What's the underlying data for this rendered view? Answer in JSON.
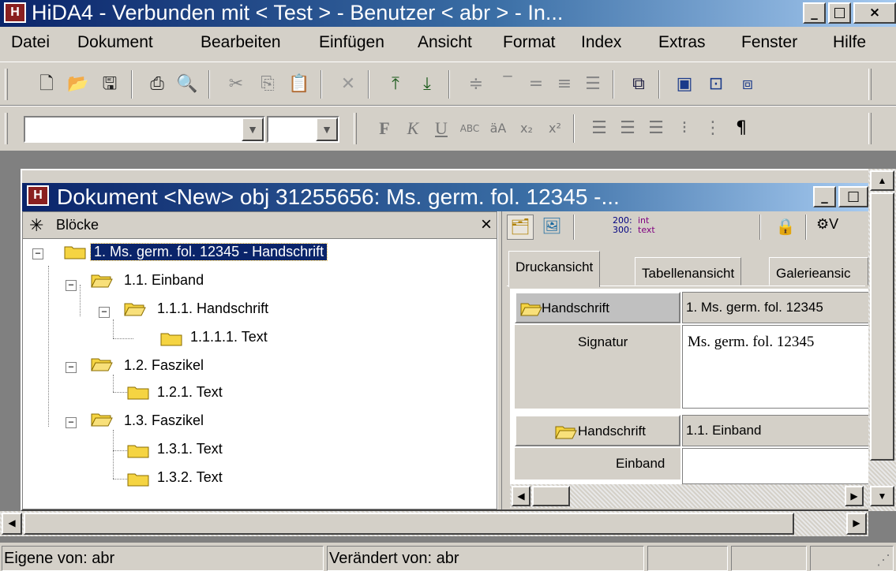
{
  "app": {
    "title": "HiDA4 - Verbunden mit < Test > - Benutzer < abr > - In...",
    "icon_letter": "H"
  },
  "menu": [
    "Datei",
    "Dokument",
    "Bearbeiten",
    "Einfügen",
    "Ansicht",
    "Format",
    "Index",
    "Extras",
    "Fenster",
    "Hilfe"
  ],
  "document": {
    "title": "Dokument <New> obj 31255656: Ms. germ. fol. 12345 -..."
  },
  "blocks": {
    "header": "Blöcke",
    "close": "×",
    "tree": [
      {
        "label": "1. Ms. germ. fol. 12345 - Handschrift",
        "level": 0,
        "selected": true
      },
      {
        "label": "1.1. Einband",
        "level": 1
      },
      {
        "label": "1.1.1. Handschrift",
        "level": 2
      },
      {
        "label": "1.1.1.1. Text",
        "level": 3
      },
      {
        "label": "1.2. Faszikel",
        "level": 1
      },
      {
        "label": "1.2.1. Text",
        "level": 2
      },
      {
        "label": "1.3. Faszikel",
        "level": 1
      },
      {
        "label": "1.3.1. Text",
        "level": 2
      },
      {
        "label": "1.3.2. Text",
        "level": 2
      }
    ]
  },
  "right": {
    "toolbar_code_lines": [
      "200:",
      "300:"
    ],
    "toolbar_code_values": [
      "int",
      "text"
    ],
    "toolbar_cut_label": "V",
    "tabs": [
      "Druckansicht",
      "Tabellenansicht",
      "Galerieansic"
    ],
    "rows": [
      {
        "header": "Handschrift",
        "value": "1. Ms. germ. fol. 12345",
        "field": "Signatur",
        "field_value": "Ms. germ. fol. 12345"
      },
      {
        "header": "Handschrift",
        "value": "1.1. Einband",
        "field": "Einband",
        "field_value": ""
      }
    ]
  },
  "status": {
    "owner": "Eigene von: abr",
    "changed": "Verändert von: abr"
  },
  "colors": {
    "title_active": "#0a246a",
    "folder": "#f5d442",
    "chrome": "#d4d0c8"
  }
}
